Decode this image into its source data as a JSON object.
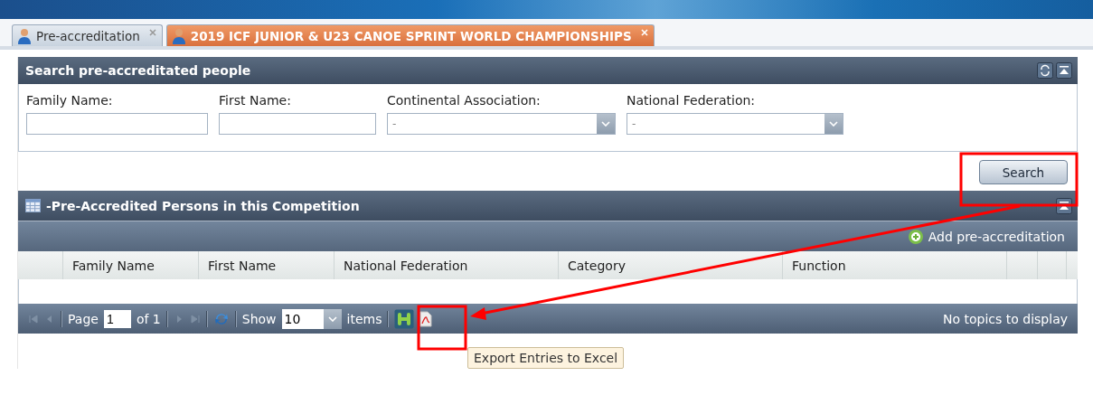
{
  "tabs": [
    {
      "label": "Pre-accreditation",
      "selected": false
    },
    {
      "label": "2019 ICF JUNIOR & U23 CANOE SPRINT WORLD CHAMPIONSHIPS",
      "selected": true
    }
  ],
  "search_panel": {
    "title": "Search pre-accreditated people",
    "fields": [
      {
        "label": "Family Name:",
        "kind": "text"
      },
      {
        "label": "First Name:",
        "kind": "text"
      },
      {
        "label": "Continental Association:",
        "kind": "select",
        "value": "-"
      },
      {
        "label": "National Federation:",
        "kind": "select",
        "value": "-"
      }
    ],
    "button": "Search"
  },
  "grid": {
    "title": "-Pre-Accredited Persons in this Competition",
    "add_button": "Add pre-accreditation",
    "columns": [
      "Family Name",
      "First Name",
      "National Federation",
      "Category",
      "Function"
    ],
    "pager": {
      "page_label": "Page",
      "page": "1",
      "of": "of 1",
      "show": "Show",
      "page_size": "10",
      "items": "items",
      "status": "No topics to display"
    }
  },
  "tooltip": "Export Entries to Excel"
}
